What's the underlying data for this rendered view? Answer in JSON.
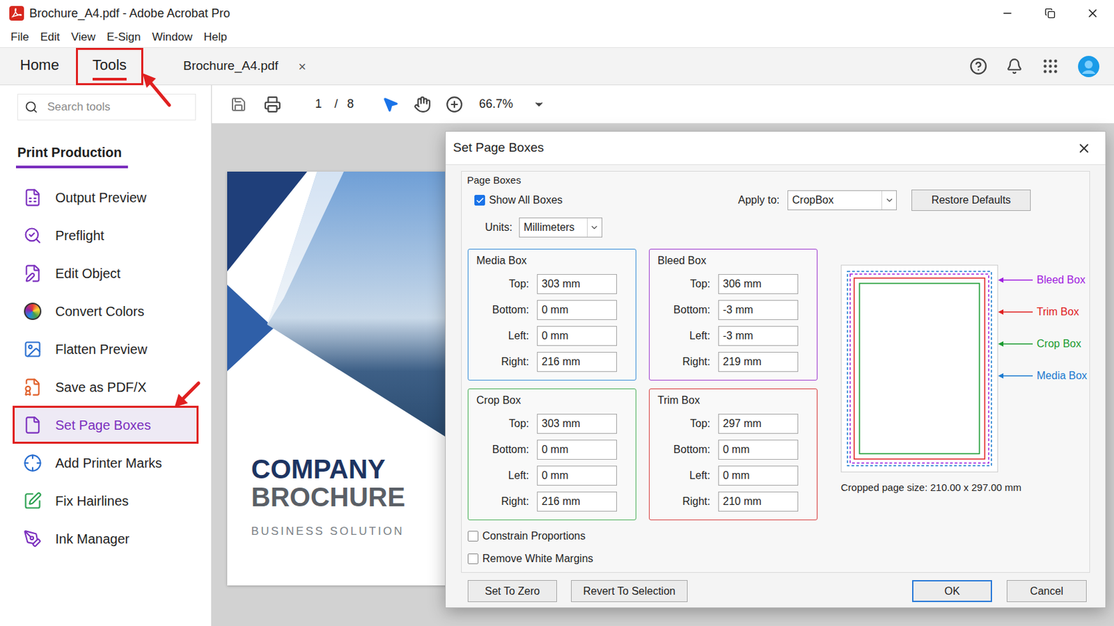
{
  "window": {
    "title": "Brochure_A4.pdf - Adobe Acrobat Pro"
  },
  "menu": [
    "File",
    "Edit",
    "View",
    "E-Sign",
    "Window",
    "Help"
  ],
  "tabs": [
    {
      "label": "Home",
      "selected": false,
      "annotated": false
    },
    {
      "label": "Tools",
      "selected": true,
      "annotated": true
    }
  ],
  "document_tab": {
    "label": "Brochure_A4.pdf",
    "close": "×"
  },
  "toolbar": {
    "page": "1",
    "separator": "/",
    "page_count": "8",
    "zoom": "66.7%"
  },
  "sidebar": {
    "search_placeholder": "Search tools",
    "section": "Print Production",
    "items": [
      {
        "label": "Output Preview",
        "selected": false,
        "annotated": false,
        "color": "#7b2fbe"
      },
      {
        "label": "Preflight",
        "selected": false,
        "annotated": false,
        "color": "#7b2fbe"
      },
      {
        "label": "Edit Object",
        "selected": false,
        "annotated": false,
        "color": "#7b2fbe"
      },
      {
        "label": "Convert Colors",
        "selected": false,
        "annotated": false,
        "color": "#7b2fbe"
      },
      {
        "label": "Flatten Preview",
        "selected": false,
        "annotated": false,
        "color": "#2a6fd0"
      },
      {
        "label": "Save as PDF/X",
        "selected": false,
        "annotated": false,
        "color": "#e0602a"
      },
      {
        "label": "Set Page Boxes",
        "selected": true,
        "annotated": true,
        "color": "#7b2fbe"
      },
      {
        "label": "Add Printer Marks",
        "selected": false,
        "annotated": false,
        "color": "#2a6fd0"
      },
      {
        "label": "Fix Hairlines",
        "selected": false,
        "annotated": false,
        "color": "#2aa050"
      },
      {
        "label": "Ink Manager",
        "selected": false,
        "annotated": false,
        "color": "#7b2fbe"
      }
    ]
  },
  "document": {
    "title_line1": "COMPANY",
    "title_line2": "BROCHURE",
    "subtitle": "BUSINESS SOLUTION"
  },
  "dialog": {
    "title": "Set Page Boxes",
    "group_label": "Page Boxes",
    "show_all_boxes": {
      "label": "Show All Boxes",
      "checked": true
    },
    "apply_to": {
      "label": "Apply to:",
      "value": "CropBox"
    },
    "restore_button": "Restore Defaults",
    "units": {
      "label": "Units:",
      "value": "Millimeters"
    },
    "boxes": [
      {
        "name": "Media Box",
        "color": "#3c8fd8",
        "fields": [
          {
            "label": "Top:",
            "value": "303 mm"
          },
          {
            "label": "Bottom:",
            "value": "0 mm"
          },
          {
            "label": "Left:",
            "value": "0 mm"
          },
          {
            "label": "Right:",
            "value": "216 mm"
          }
        ]
      },
      {
        "name": "Bleed Box",
        "color": "#a040d0",
        "fields": [
          {
            "label": "Top:",
            "value": "306 mm"
          },
          {
            "label": "Bottom:",
            "value": "-3 mm"
          },
          {
            "label": "Left:",
            "value": "-3 mm"
          },
          {
            "label": "Right:",
            "value": "219 mm"
          }
        ]
      },
      {
        "name": "Crop Box",
        "color": "#4cb05a",
        "fields": [
          {
            "label": "Top:",
            "value": "303 mm"
          },
          {
            "label": "Bottom:",
            "value": "0 mm"
          },
          {
            "label": "Left:",
            "value": "0 mm"
          },
          {
            "label": "Right:",
            "value": "216 mm"
          }
        ]
      },
      {
        "name": "Trim Box",
        "color": "#d94040",
        "fields": [
          {
            "label": "Top:",
            "value": "297 mm"
          },
          {
            "label": "Bottom:",
            "value": "0 mm"
          },
          {
            "label": "Left:",
            "value": "0 mm"
          },
          {
            "label": "Right:",
            "value": "210 mm"
          }
        ]
      }
    ],
    "legend": [
      {
        "label": "Bleed Box",
        "color": "#a020e0",
        "kind": "dashed"
      },
      {
        "label": "Trim Box",
        "color": "#e02020",
        "kind": "solid"
      },
      {
        "label": "Crop Box",
        "color": "#1a9b30",
        "kind": "solid"
      },
      {
        "label": "Media Box",
        "color": "#1a7ad0",
        "kind": "dashed"
      }
    ],
    "cropped_size": "Cropped page size: 210.00 x 297.00 mm",
    "options": [
      {
        "label": "Constrain Proportions",
        "checked": false
      },
      {
        "label": "Remove White Margins",
        "checked": false
      }
    ],
    "left_buttons": [
      {
        "label": "Set To Zero",
        "default": false
      },
      {
        "label": "Revert To Selection",
        "default": false
      }
    ],
    "right_buttons": [
      {
        "label": "OK",
        "default": true
      },
      {
        "label": "Cancel",
        "default": false
      }
    ]
  }
}
